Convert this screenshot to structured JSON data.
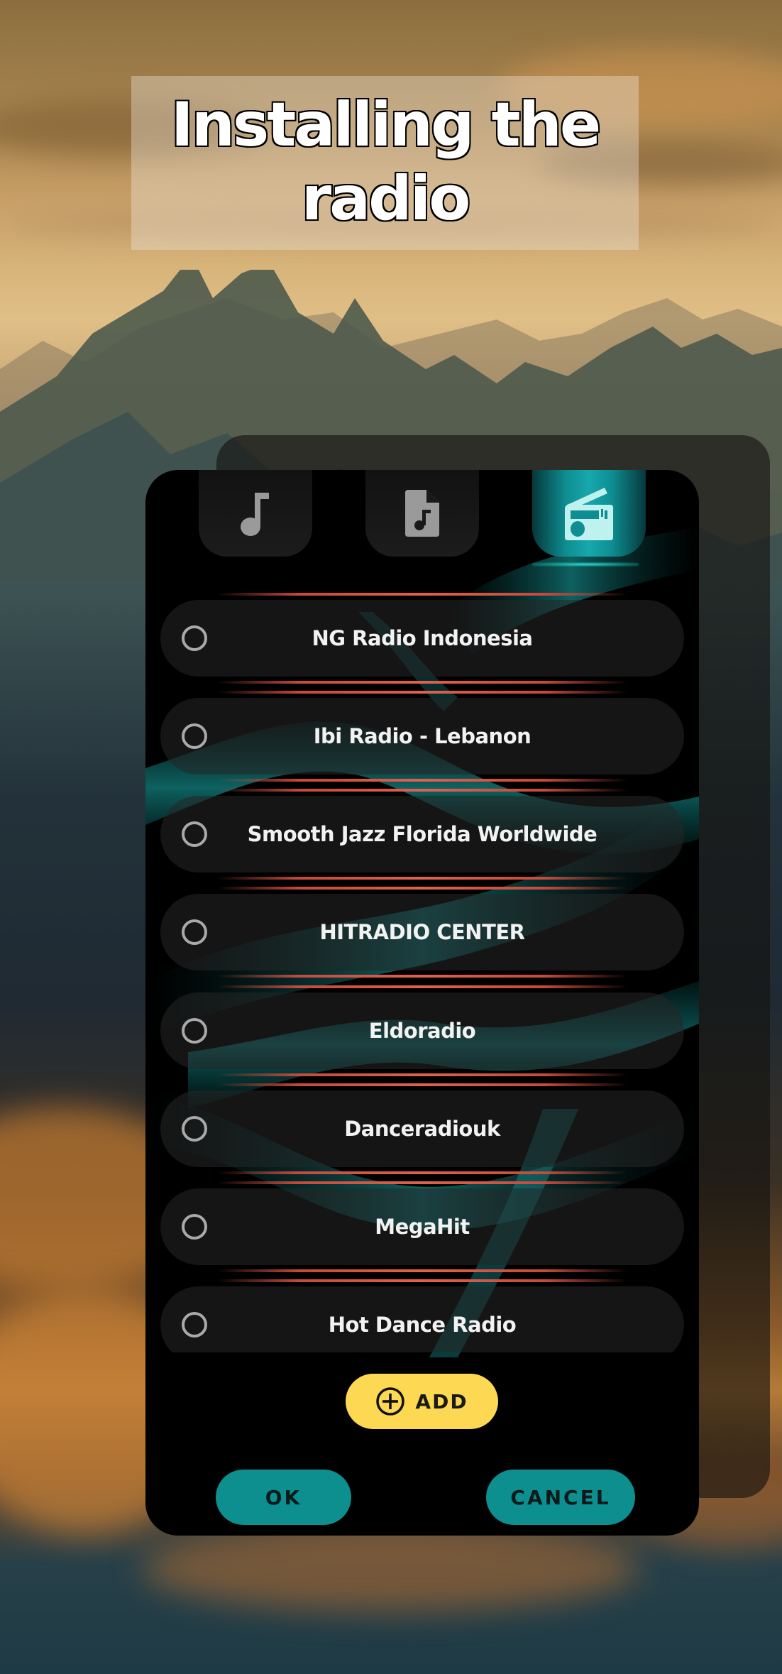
{
  "title": {
    "line1": "Installing the",
    "line2": "radio"
  },
  "dialog": {
    "tabs": [
      {
        "name": "music",
        "icon": "music-note-icon",
        "active": false
      },
      {
        "name": "audio-file",
        "icon": "audio-file-icon",
        "active": false
      },
      {
        "name": "radio",
        "icon": "radio-icon",
        "active": true
      }
    ],
    "stations": [
      {
        "label": "NG Radio Indonesia",
        "selected": false
      },
      {
        "label": "Ibi Radio - Lebanon",
        "selected": false
      },
      {
        "label": "Smooth Jazz Florida Worldwide",
        "selected": false
      },
      {
        "label": "HITRADIO CENTER",
        "selected": false
      },
      {
        "label": "Eldoradio",
        "selected": false
      },
      {
        "label": "Danceradiouk",
        "selected": false
      },
      {
        "label": "MegaHit",
        "selected": false
      },
      {
        "label": "Hot Dance Radio",
        "selected": false
      }
    ],
    "add_label": "ADD",
    "ok_label": "OK",
    "cancel_label": "CANCEL"
  },
  "colors": {
    "accent_teal": "#0d8e8f",
    "add_yellow": "#fdd853",
    "separator_red": "#e2604c",
    "dialog_bg": "#000000",
    "tab_active_glow": "#26e0d2"
  }
}
